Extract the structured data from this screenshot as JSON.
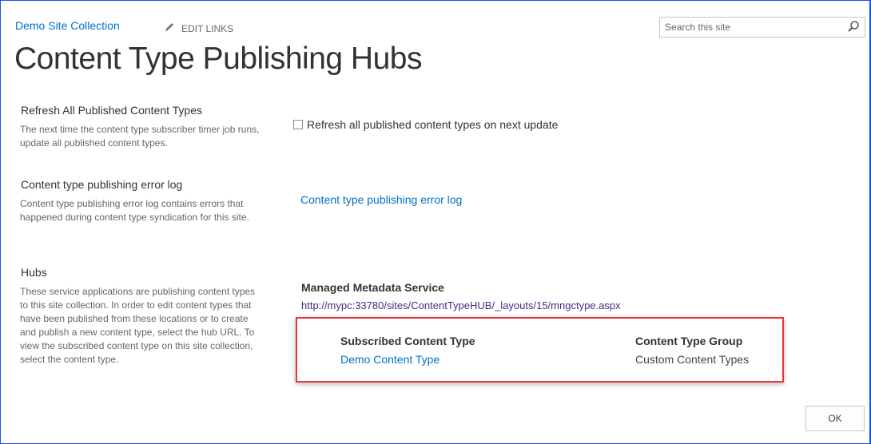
{
  "header": {
    "site_title": "Demo Site Collection",
    "edit_links": "EDIT LINKS",
    "page_title": "Content Type Publishing Hubs",
    "search_placeholder": "Search this site"
  },
  "sections": [
    {
      "heading": "Refresh All Published Content Types",
      "description": "The next time the content type subscriber timer job runs, update all published content types.",
      "checkbox_label": "Refresh all published content types on next update",
      "checked": false
    },
    {
      "heading": "Content type publishing error log",
      "description": "Content type publishing error log contains errors that happened during content type syndication for this site.",
      "link": "Content type publishing error log"
    },
    {
      "heading": "Hubs",
      "description": "These service applications are publishing content types to this site collection.  In order to edit content types that have been published from these locations or to create and publish a new content type, select the hub URL.  To view the subscribed content type on this site collection, select the content type.",
      "service_name": "Managed Metadata Service",
      "hub_url": "http://mypc:33780/sites/ContentTypeHUB/_layouts/15/mngctype.aspx",
      "table": {
        "headers": [
          "Subscribed Content Type",
          "Content Type Group"
        ],
        "rows": [
          [
            "Demo Content Type",
            "Custom Content Types"
          ]
        ]
      }
    }
  ],
  "buttons": {
    "ok": "OK"
  },
  "colors": {
    "link": "#0072c6",
    "highlight": "#e8353a"
  }
}
